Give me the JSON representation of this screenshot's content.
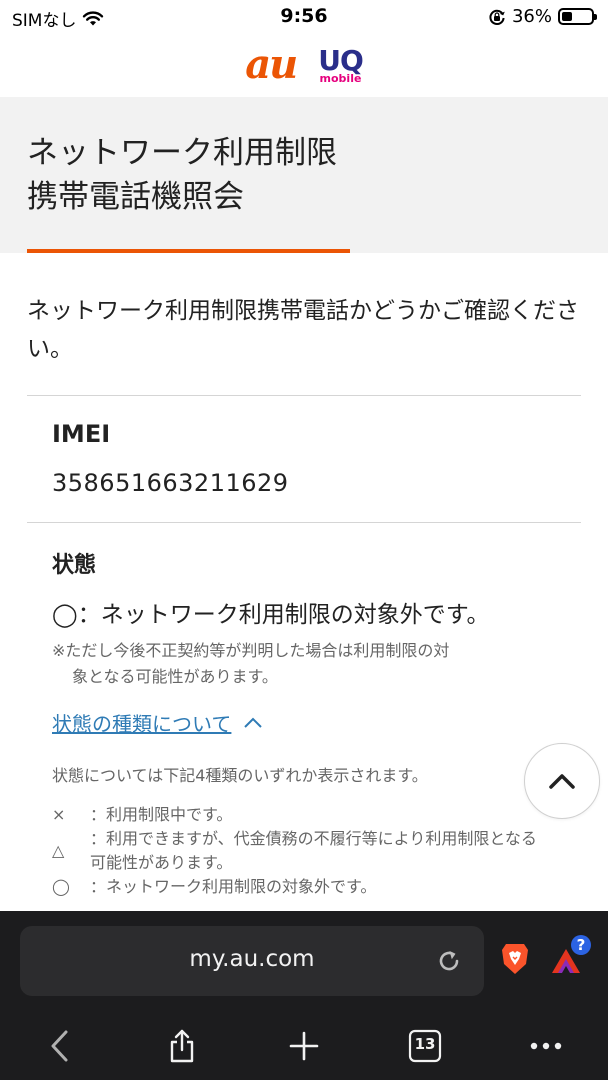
{
  "status_bar": {
    "carrier": "SIMなし",
    "time": "9:56",
    "battery_percent": "36%",
    "battery_level": 0.36
  },
  "brand": {
    "au_logo": "au",
    "uq_logo_top": "UQ",
    "uq_logo_bottom": "mobile"
  },
  "page": {
    "title_line1": "ネットワーク利用制限",
    "title_line2": "携帯電話機照会",
    "intro": "ネットワーク利用制限携帯電話かどうかご確認ください。"
  },
  "imei": {
    "label": "IMEI",
    "value": "358651663211629"
  },
  "state": {
    "label": "状態",
    "value": "◯：ネットワーク利用制限の対象外です。",
    "note_line1": "※ただし今後不正契約等が判明した場合は利用制限の対",
    "note_line2": "象となる可能性があります。"
  },
  "types": {
    "link_label": "状態の種類について",
    "description": "状態については下記4種類のいずれか表示されます。",
    "items": [
      {
        "symbol": "×",
        "text": "：利用制限中です。"
      },
      {
        "symbol": "△",
        "text": "：利用できますが、代金債務の不履行等により利用制限となる可能性があります。"
      },
      {
        "symbol": "◯",
        "text": "：ネットワーク利用制限の対象外です。"
      }
    ]
  },
  "browser": {
    "url": "my.au.com",
    "tab_count": "13",
    "rewards_badge": "?"
  },
  "colors": {
    "accent": "#eb5505",
    "link": "#2f7bb5",
    "title_band": "#f2f2f2",
    "chrome_bg": "#1c1c1e"
  },
  "icons": [
    "wifi-icon",
    "screen-lock-icon",
    "battery-icon",
    "scroll-top-icon",
    "reload-icon",
    "brave-icon",
    "rewards-icon",
    "back-icon",
    "share-icon",
    "plus-icon",
    "tabs-icon",
    "more-icon"
  ]
}
